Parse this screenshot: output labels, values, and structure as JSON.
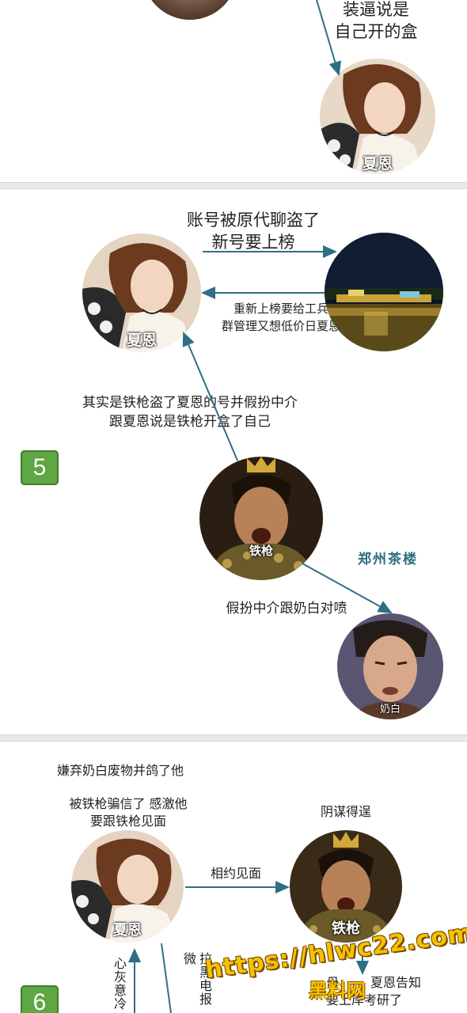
{
  "panel_top": {
    "label_line1": "装逼说是",
    "label_line2": "自己开的盒",
    "avatar_xiaen": "夏恩"
  },
  "panel5": {
    "badge": "5",
    "top_label_line1": "账号被原代聊盗了",
    "top_label_line2": "新号要上榜",
    "back_label_line1": "重新上榜要给工兵券",
    "back_label_line2": "群管理又想低价日夏恩",
    "teahouse": "郑州茶楼",
    "avatar_xiaen": "夏恩",
    "middle_label_line1": "其实是铁枪盗了夏恩的号并假扮中介",
    "middle_label_line2": "跟夏恩说是铁枪开盒了自己",
    "avatar_tieqiang": "铁枪",
    "bottom_label": "假扮中介跟奶白对喷",
    "avatar_naibai": "奶白"
  },
  "panel6": {
    "badge": "6",
    "label_abandon": "嫌弃奶白废物并鸽了他",
    "label_fooled_line1": "被铁枪骗信了 感激他",
    "label_fooled_line2": "要跟铁枪见面",
    "label_plot": "阴谋得逞",
    "label_meet": "相约见面",
    "avatar_xiaen": "夏恩",
    "avatar_tieqiang": "铁枪",
    "vertical_left": "心灰意冷",
    "vertical_right": "拉黑电报微",
    "label_inform_line1": "夏恩告知",
    "label_inform_line2": "要上岸考研了",
    "label_inform_prefix": "母"
  },
  "watermark": {
    "url": "https://hlwc22.com",
    "site": "黑料网"
  }
}
